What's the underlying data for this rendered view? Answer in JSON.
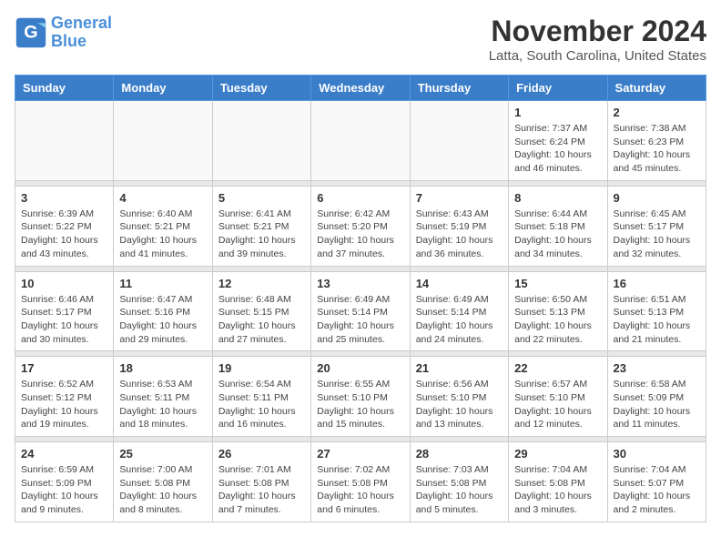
{
  "logo": {
    "line1": "General",
    "line2": "Blue"
  },
  "title": "November 2024",
  "location": "Latta, South Carolina, United States",
  "days_of_week": [
    "Sunday",
    "Monday",
    "Tuesday",
    "Wednesday",
    "Thursday",
    "Friday",
    "Saturday"
  ],
  "weeks": [
    [
      {
        "day": "",
        "info": ""
      },
      {
        "day": "",
        "info": ""
      },
      {
        "day": "",
        "info": ""
      },
      {
        "day": "",
        "info": ""
      },
      {
        "day": "",
        "info": ""
      },
      {
        "day": "1",
        "info": "Sunrise: 7:37 AM\nSunset: 6:24 PM\nDaylight: 10 hours and 46 minutes."
      },
      {
        "day": "2",
        "info": "Sunrise: 7:38 AM\nSunset: 6:23 PM\nDaylight: 10 hours and 45 minutes."
      }
    ],
    [
      {
        "day": "3",
        "info": "Sunrise: 6:39 AM\nSunset: 5:22 PM\nDaylight: 10 hours and 43 minutes."
      },
      {
        "day": "4",
        "info": "Sunrise: 6:40 AM\nSunset: 5:21 PM\nDaylight: 10 hours and 41 minutes."
      },
      {
        "day": "5",
        "info": "Sunrise: 6:41 AM\nSunset: 5:21 PM\nDaylight: 10 hours and 39 minutes."
      },
      {
        "day": "6",
        "info": "Sunrise: 6:42 AM\nSunset: 5:20 PM\nDaylight: 10 hours and 37 minutes."
      },
      {
        "day": "7",
        "info": "Sunrise: 6:43 AM\nSunset: 5:19 PM\nDaylight: 10 hours and 36 minutes."
      },
      {
        "day": "8",
        "info": "Sunrise: 6:44 AM\nSunset: 5:18 PM\nDaylight: 10 hours and 34 minutes."
      },
      {
        "day": "9",
        "info": "Sunrise: 6:45 AM\nSunset: 5:17 PM\nDaylight: 10 hours and 32 minutes."
      }
    ],
    [
      {
        "day": "10",
        "info": "Sunrise: 6:46 AM\nSunset: 5:17 PM\nDaylight: 10 hours and 30 minutes."
      },
      {
        "day": "11",
        "info": "Sunrise: 6:47 AM\nSunset: 5:16 PM\nDaylight: 10 hours and 29 minutes."
      },
      {
        "day": "12",
        "info": "Sunrise: 6:48 AM\nSunset: 5:15 PM\nDaylight: 10 hours and 27 minutes."
      },
      {
        "day": "13",
        "info": "Sunrise: 6:49 AM\nSunset: 5:14 PM\nDaylight: 10 hours and 25 minutes."
      },
      {
        "day": "14",
        "info": "Sunrise: 6:49 AM\nSunset: 5:14 PM\nDaylight: 10 hours and 24 minutes."
      },
      {
        "day": "15",
        "info": "Sunrise: 6:50 AM\nSunset: 5:13 PM\nDaylight: 10 hours and 22 minutes."
      },
      {
        "day": "16",
        "info": "Sunrise: 6:51 AM\nSunset: 5:13 PM\nDaylight: 10 hours and 21 minutes."
      }
    ],
    [
      {
        "day": "17",
        "info": "Sunrise: 6:52 AM\nSunset: 5:12 PM\nDaylight: 10 hours and 19 minutes."
      },
      {
        "day": "18",
        "info": "Sunrise: 6:53 AM\nSunset: 5:11 PM\nDaylight: 10 hours and 18 minutes."
      },
      {
        "day": "19",
        "info": "Sunrise: 6:54 AM\nSunset: 5:11 PM\nDaylight: 10 hours and 16 minutes."
      },
      {
        "day": "20",
        "info": "Sunrise: 6:55 AM\nSunset: 5:10 PM\nDaylight: 10 hours and 15 minutes."
      },
      {
        "day": "21",
        "info": "Sunrise: 6:56 AM\nSunset: 5:10 PM\nDaylight: 10 hours and 13 minutes."
      },
      {
        "day": "22",
        "info": "Sunrise: 6:57 AM\nSunset: 5:10 PM\nDaylight: 10 hours and 12 minutes."
      },
      {
        "day": "23",
        "info": "Sunrise: 6:58 AM\nSunset: 5:09 PM\nDaylight: 10 hours and 11 minutes."
      }
    ],
    [
      {
        "day": "24",
        "info": "Sunrise: 6:59 AM\nSunset: 5:09 PM\nDaylight: 10 hours and 9 minutes."
      },
      {
        "day": "25",
        "info": "Sunrise: 7:00 AM\nSunset: 5:08 PM\nDaylight: 10 hours and 8 minutes."
      },
      {
        "day": "26",
        "info": "Sunrise: 7:01 AM\nSunset: 5:08 PM\nDaylight: 10 hours and 7 minutes."
      },
      {
        "day": "27",
        "info": "Sunrise: 7:02 AM\nSunset: 5:08 PM\nDaylight: 10 hours and 6 minutes."
      },
      {
        "day": "28",
        "info": "Sunrise: 7:03 AM\nSunset: 5:08 PM\nDaylight: 10 hours and 5 minutes."
      },
      {
        "day": "29",
        "info": "Sunrise: 7:04 AM\nSunset: 5:08 PM\nDaylight: 10 hours and 3 minutes."
      },
      {
        "day": "30",
        "info": "Sunrise: 7:04 AM\nSunset: 5:07 PM\nDaylight: 10 hours and 2 minutes."
      }
    ]
  ]
}
